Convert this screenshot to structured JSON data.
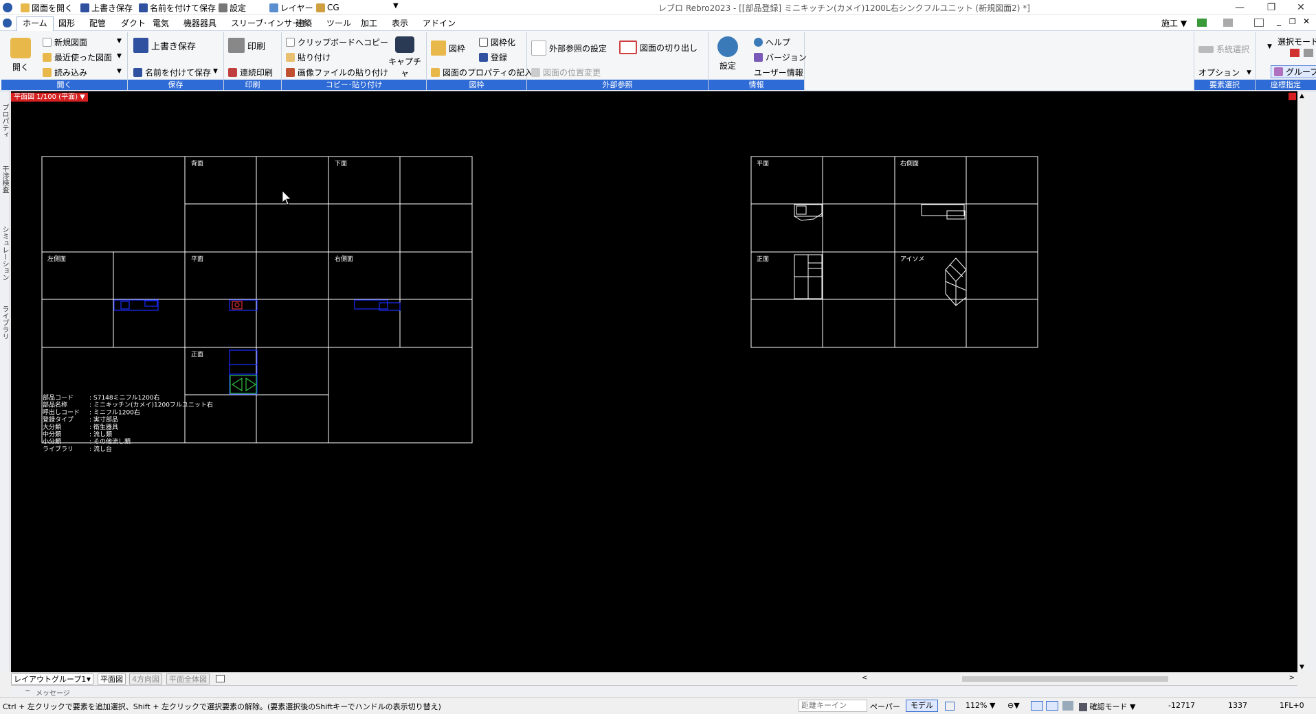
{
  "title_bar": {
    "quick_access": [
      "図面を開く",
      "上書き保存",
      "名前を付けて保存",
      "設定",
      "レイヤー",
      "CG"
    ],
    "window_title": "レブロ Rebro2023 - [[部品登録] ミニキッチン(カメイ)1200L右シンクフルユニット (新規図面2) *]",
    "window_buttons": [
      "—",
      "❐",
      "✕"
    ]
  },
  "menu": {
    "tabs": [
      "ホーム",
      "図形",
      "配管",
      "ダクト",
      "電気",
      "機器器具",
      "スリーブ･インサート",
      "建築",
      "ツール",
      "加工",
      "表示",
      "アドイン"
    ],
    "right_label": "施工"
  },
  "ribbon": {
    "open_group": {
      "label": "開く",
      "open_button": "開く",
      "items": [
        "新規図面",
        "最近使った図面",
        "読み込み"
      ]
    },
    "save_group": {
      "label": "保存",
      "items": [
        "上書き保存",
        "名前を付けて保存"
      ]
    },
    "print_group": {
      "label": "印刷",
      "items": [
        "印刷",
        "連続印刷"
      ]
    },
    "copy_group": {
      "label": "コピー･貼り付け",
      "items": [
        "クリップボードへコピー",
        "貼り付け",
        "画像ファイルの貼り付け"
      ],
      "capture": "キャプチャ"
    },
    "frame_group": {
      "label": "図枠",
      "items": [
        "図枠",
        "図枠化",
        "登録",
        "図面のプロパティの記入"
      ]
    },
    "xref_group": {
      "label": "外部参照",
      "items": [
        "外部参照の設定",
        "図面の切り出し",
        "図面の位置変更"
      ]
    },
    "info_group": {
      "label": "情報",
      "settings": "設定",
      "items": [
        "ヘルプ",
        "バージョン",
        "ユーザー情報"
      ]
    },
    "select_group": {
      "label": "要素選択",
      "items": [
        "系統選択",
        "オプション"
      ],
      "mode": "選択モード"
    },
    "coord_group": {
      "label": "座標指定",
      "items": [
        "グループ"
      ]
    }
  },
  "side_tabs": {
    "left": [
      "プロパティ",
      "干渉検査",
      "シミュレーション",
      "ライブラリ"
    ]
  },
  "canvas": {
    "view_label": "平面図 1/100 (平面)",
    "left_views": [
      "背面",
      "下面",
      "左側面",
      "平面",
      "右側面",
      "正面"
    ],
    "right_views": [
      "平面",
      "右側面",
      "正面",
      "アイソメ"
    ],
    "part_info": [
      {
        "key": "部品コード",
        "value": "S7148ミニフル1200右"
      },
      {
        "key": "部品名称",
        "value": "ミニキッチン(カメイ)1200フルユニット右"
      },
      {
        "key": "呼出しコード",
        "value": "ミニフル1200右"
      },
      {
        "key": "登録タイプ",
        "value": "実寸部品"
      },
      {
        "key": "大分類",
        "value": "衛生器具"
      },
      {
        "key": "中分類",
        "value": "流し類"
      },
      {
        "key": "小分類",
        "value": "その他流し類"
      },
      {
        "key": "ライブラリ",
        "value": "流し台"
      }
    ]
  },
  "bottom_tabs": {
    "layout_group": "レイアウトグループ1",
    "tabs": [
      "平面図",
      "4方向図",
      "平面全体図"
    ]
  },
  "message_bar": "メッセージ",
  "status": {
    "hint": "Ctrl + 左クリックで要素を追加選択、Shift + 左クリックで選択要素の解除。(要素選択後のShiftキーでハンドルの表示切り替え)",
    "distance": "距離キーイン",
    "paper": "ペーパー",
    "model": "モデル",
    "zoom": "112%",
    "mode": "確認モード",
    "x": "-12717",
    "y": "1337",
    "floor": "1FL+0"
  },
  "colors": {
    "accent": "#2f6bd6",
    "canvas": "#000000",
    "grid": "#ffffff",
    "part": "#1a2dff"
  }
}
